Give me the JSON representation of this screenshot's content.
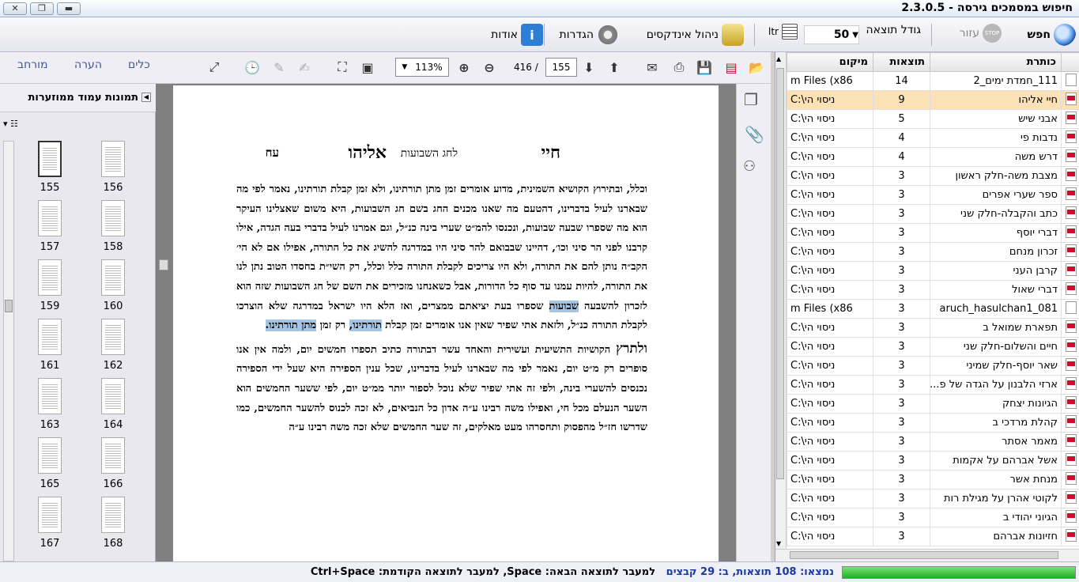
{
  "window": {
    "title": "חיפוש במסמכים גירסה - 2.3.0.5"
  },
  "toolbar": {
    "search": "חפש",
    "help": "עזור",
    "result_size_label": "גודל תוצאה",
    "result_size_value": "50",
    "ltr": "ltr",
    "index_mgmt": "ניהול אינדקסים",
    "settings": "הגדרות",
    "about": "אודות"
  },
  "pdf": {
    "zoom": "113%",
    "page_current": "155",
    "page_total": "416",
    "tabs": {
      "tools": "כלים",
      "comment": "הערה",
      "expanded": "מורחב"
    },
    "thumb_title": "תמונות עמוד ממוזערות",
    "thumbs": [
      "155",
      "156",
      "157",
      "158",
      "159",
      "160",
      "161",
      "162",
      "163",
      "164",
      "165",
      "166",
      "167",
      "168"
    ],
    "page": {
      "h_right": "חיי",
      "h_center": "אליהו",
      "h_sub": "לחג השבועות",
      "h_left": "עח",
      "p1a": "וכלל, ובתירוץ הקושיא השמינית, מדוע אומרים זמן מתן תורתינו, ולא זמן קבלת תורתינו, נאמר לפי מה שבארנו לעיל בדברינו, דהטעם מה שאנו מכנים החג בשם חג השבועות, היא משום שאצלינו העיקר הוא מה שספרו שבעה שבועות, ונכנסו להמ״ט שערי בינה כנ״ל, וגם אמרנו לעיל בדברי בעה הגדה, אילו קרבנו לפני הר סיני וכו׳, דהיינו שבבואם להר סיני היו במדרגה להשיג את כל התורה, אפילו אם לא הי׳ הקב״ה נותן להם את התורה, ולא היו צריכים לקבלת התורה כלל וכלל, רק השי״ת בחסדו הטוב נתן לנו את התורה, להיות עמנו עד סוף כל הדורות, אבל כשאנחנו מזכירים את השם של חג השבועות שזה הוא לזכרון להשבעה",
      "hl1": "שבועות",
      "p1b": " שספרו בעת יציאתם ממצרים, ואז הלא היו ישראל במדרגה שלא הוצרכו לקבלת התורה כנ״ל, ולזאת אתי שפיר שאין אנו אומרים זמן קבלת ",
      "hl2": "תורתינו,",
      "p1c": " רק זמן ",
      "hl3": "מתן תורתינו.",
      "p2_lead": "ולתרץ",
      "p2": " הקושיות התשיעית ועשירית והאחד עשר דבתורה כתיב תספרו חמשים יום, ולמה אין אנו סופרים רק מ״ט יום, נאמר לפי מה שבארנו לעיל בדברינו, שכל ענין הספירה היא שעל ידי הספירה נכנסים להשערי בינה, ולפי זה אתי שפיר שלא נוכל לספור יותר ממ״ט יום, לפי ששער החמשים הוא השער הנעלם מכל חי, ואפילו משה רבינו ע״ה אדון כל הנביאים, לא זכה לכנוס להשער החמשים, כמו שדרשו חז״ל מהפסוק ותחסרהו מעט מאלקים, זה שער החמשים שלא זכה משה רבינו ע״ה"
    }
  },
  "results": {
    "headers": {
      "title": "כותרת",
      "count": "תוצאות",
      "location": "מיקום"
    },
    "rows": [
      {
        "title": "111_חמדת ימים_2",
        "count": "14",
        "loc": "m Files (x86",
        "type": "txt"
      },
      {
        "title": "חיי אליהו",
        "count": "9",
        "loc": "C:\\ניסוי הי",
        "type": "pdf",
        "selected": true
      },
      {
        "title": "אבני שיש",
        "count": "5",
        "loc": "C:\\ניסוי הי",
        "type": "pdf"
      },
      {
        "title": "נדבות פי",
        "count": "4",
        "loc": "C:\\ניסוי הי",
        "type": "pdf"
      },
      {
        "title": "דרש משה",
        "count": "4",
        "loc": "C:\\ניסוי הי",
        "type": "pdf"
      },
      {
        "title": "מצבת משה-חלק ראשון",
        "count": "3",
        "loc": "C:\\ניסוי הי",
        "type": "pdf"
      },
      {
        "title": "ספר שערי אפרים",
        "count": "3",
        "loc": "C:\\ניסוי הי",
        "type": "pdf"
      },
      {
        "title": "כתב והקבלה-חלק שני",
        "count": "3",
        "loc": "C:\\ניסוי הי",
        "type": "pdf"
      },
      {
        "title": "דברי יוסף",
        "count": "3",
        "loc": "C:\\ניסוי הי",
        "type": "pdf"
      },
      {
        "title": "זכרון מנחם",
        "count": "3",
        "loc": "C:\\ניסוי הי",
        "type": "pdf"
      },
      {
        "title": "קרבן העני",
        "count": "3",
        "loc": "C:\\ניסוי הי",
        "type": "pdf"
      },
      {
        "title": "דברי שאול",
        "count": "3",
        "loc": "C:\\ניסוי הי",
        "type": "pdf"
      },
      {
        "title": "aruch_hasulchan1_081",
        "count": "3",
        "loc": "m Files (x86",
        "type": "txt"
      },
      {
        "title": "תפארת שמואל ב",
        "count": "3",
        "loc": "C:\\ניסוי הי",
        "type": "pdf"
      },
      {
        "title": "חיים והשלום-חלק שני",
        "count": "3",
        "loc": "C:\\ניסוי הי",
        "type": "pdf"
      },
      {
        "title": "שאר יוסף-חלק שמיני",
        "count": "3",
        "loc": "C:\\ניסוי הי",
        "type": "pdf"
      },
      {
        "title": "ארזי הלבנון על הגדה של פ...",
        "count": "3",
        "loc": "C:\\ניסוי הי",
        "type": "pdf"
      },
      {
        "title": "הגיונות יצחק",
        "count": "3",
        "loc": "C:\\ניסוי הי",
        "type": "pdf"
      },
      {
        "title": "קהלת מרדכי ב",
        "count": "3",
        "loc": "C:\\ניסוי הי",
        "type": "pdf"
      },
      {
        "title": "מאמר אסתר",
        "count": "3",
        "loc": "C:\\ניסוי הי",
        "type": "pdf"
      },
      {
        "title": "אשל אברהם על אקמות",
        "count": "3",
        "loc": "C:\\ניסוי הי",
        "type": "pdf"
      },
      {
        "title": "מנחת אשר",
        "count": "3",
        "loc": "C:\\ניסוי הי",
        "type": "pdf"
      },
      {
        "title": "לקוטי אהרן על מגילת רות",
        "count": "3",
        "loc": "C:\\ניסוי הי",
        "type": "pdf"
      },
      {
        "title": "הגיוני יהודי ב",
        "count": "3",
        "loc": "C:\\ניסוי הי",
        "type": "pdf"
      },
      {
        "title": "חזיונות אברהם",
        "count": "3",
        "loc": "C:\\ניסוי הי",
        "type": "pdf"
      }
    ]
  },
  "status": {
    "summary": "נמצאו: 108 תוצאות, ב: 29 קבצים",
    "hint": "למעבר לתוצאה הבאה: Space, למעבר לתוצאה הקודמת: Ctrl+Space",
    "progress": 1.0
  }
}
